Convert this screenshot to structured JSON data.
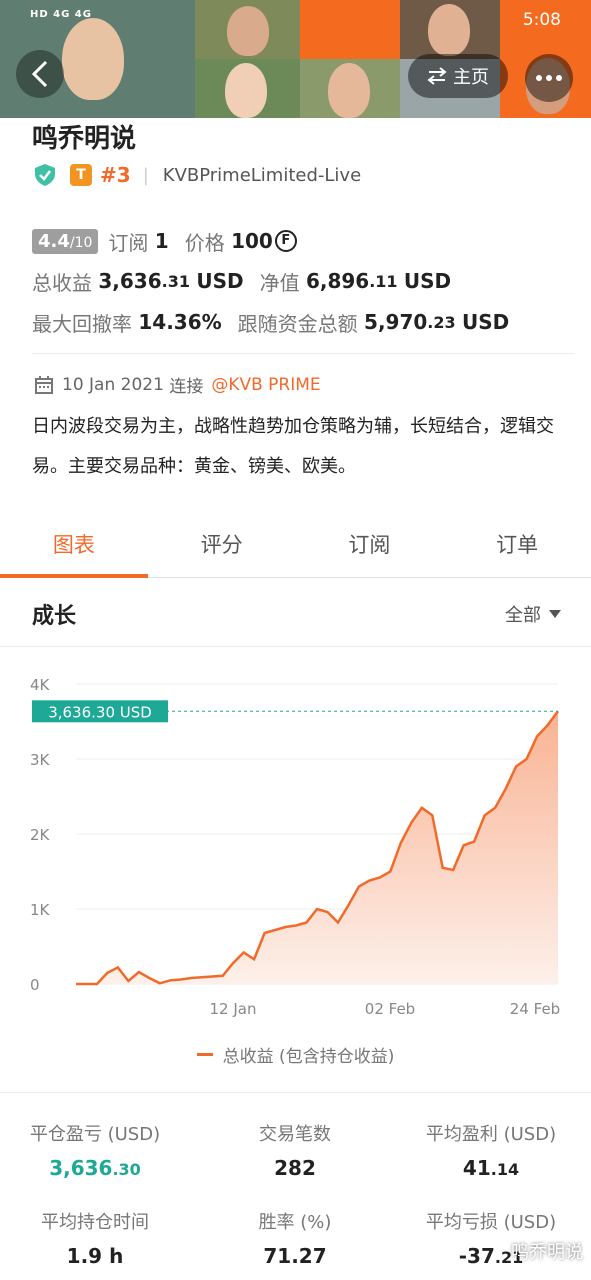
{
  "status_bar": {
    "network": "HD 4G 4G",
    "time": "5:08"
  },
  "header": {
    "home_label": "主页"
  },
  "profile": {
    "name": "鸣乔明说",
    "rank": "#3",
    "broker": "KVBPrimeLimited-Live",
    "tier_badge": "T",
    "score": "4.4",
    "score_max": "/10",
    "subscribe_label": "订阅",
    "subscribe_count": "1",
    "price_label": "价格",
    "price_value": "100",
    "price_unit": "F",
    "total_profit_label": "总收益",
    "total_profit_int": "3,636",
    "total_profit_dec": ".31",
    "total_profit_cur": "USD",
    "net_value_label": "净值",
    "net_value_int": "6,896",
    "net_value_dec": ".11",
    "net_value_cur": "USD",
    "max_drawdown_label": "最大回撤率",
    "max_drawdown_value": "14.36%",
    "follow_funds_label": "跟随资金总额",
    "follow_funds_int": "5,970",
    "follow_funds_dec": ".23",
    "follow_funds_cur": "USD",
    "join_date": "10 Jan 2021",
    "join_label": "连接",
    "join_link": "@KVB PRIME",
    "description": "日内波段交易为主，战略性趋势加仓策略为辅，长短结合，逻辑交易。主要交易品种：黄金、镑美、欧美。"
  },
  "tabs": [
    {
      "label": "图表",
      "active": true
    },
    {
      "label": "评分",
      "active": false
    },
    {
      "label": "订阅",
      "active": false
    },
    {
      "label": "订单",
      "active": false
    }
  ],
  "growth": {
    "title": "成长",
    "range_label": "全部"
  },
  "chart_data": {
    "type": "area",
    "ylim": [
      0,
      4000
    ],
    "y_ticks": [
      "0",
      "1K",
      "2K",
      "3K",
      "4K"
    ],
    "x_ticks": [
      "12 Jan",
      "02 Feb",
      "24 Feb"
    ],
    "current_label": "3,636.30 USD",
    "legend": "总收益 (包含持仓收益)",
    "series": [
      {
        "name": "总收益 (包含持仓收益)",
        "values": [
          0,
          0,
          0,
          150,
          220,
          40,
          160,
          80,
          10,
          50,
          60,
          80,
          90,
          100,
          110,
          280,
          420,
          330,
          680,
          720,
          760,
          780,
          820,
          1000,
          960,
          820,
          1050,
          1300,
          1380,
          1420,
          1500,
          1880,
          2150,
          2350,
          2250,
          1550,
          1520,
          1850,
          1900,
          2250,
          2350,
          2600,
          2900,
          3000,
          3300,
          3450,
          3636
        ]
      }
    ],
    "colors": {
      "line": "#f26a2a",
      "fill_top": "#f9b394",
      "fill_bottom": "#fdf0ea",
      "badge": "#1ea896"
    }
  },
  "metrics": [
    {
      "label": "平仓盈亏 (USD)",
      "value_int": "3,636",
      "value_dec": ".30",
      "teal": true
    },
    {
      "label": "交易笔数",
      "value_int": "282",
      "value_dec": "",
      "teal": false
    },
    {
      "label": "平均盈利 (USD)",
      "value_int": "41",
      "value_dec": ".14",
      "teal": false
    },
    {
      "label": "平均持仓时间",
      "value_int": "1.9 h",
      "value_dec": "",
      "teal": false
    },
    {
      "label": "胜率 (%)",
      "value_int": "71.27",
      "value_dec": "",
      "teal": false
    },
    {
      "label": "平均亏损 (USD)",
      "value_int": "-37",
      "value_dec": ".21",
      "teal": false
    }
  ],
  "watermark": "鸣乔明说"
}
